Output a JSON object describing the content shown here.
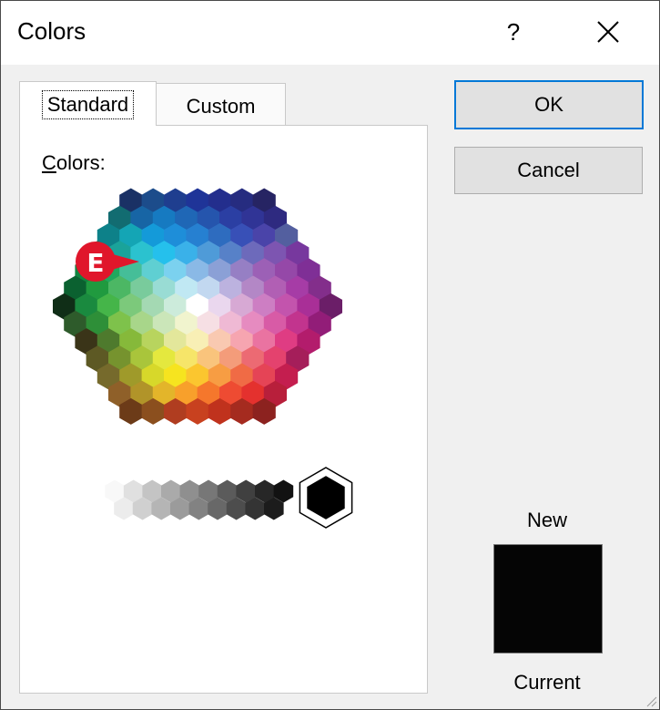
{
  "window": {
    "title": "Colors",
    "help_label": "?"
  },
  "tabs": [
    {
      "label": "Standard",
      "selected": true
    },
    {
      "label": "Custom",
      "selected": false
    }
  ],
  "panel": {
    "colors_label": "Colors:",
    "accelerator": "C",
    "label_rest": "olors:"
  },
  "buttons": {
    "ok_label": "OK",
    "cancel_label": "Cancel"
  },
  "preview": {
    "new_label": "New",
    "current_label": "Current",
    "new_color": "#050505",
    "current_color": "#050505"
  },
  "callout": {
    "letter": "E",
    "color": "#e0162b"
  },
  "selected_color": "#000000",
  "palette": {
    "rows": [
      [
        "#1a3165",
        "#1c4c8b",
        "#1f3e8f",
        "#1f3498",
        "#232e8d",
        "#262c80",
        "#262463"
      ],
      [
        "#126c71",
        "#1765a5",
        "#167ac1",
        "#1f67b6",
        "#2555ad",
        "#2b3fa3",
        "#303496",
        "#2e2a80"
      ],
      [
        "#0d8189",
        "#14a5b5",
        "#149ad9",
        "#1e8ed9",
        "#2680d1",
        "#2e6cbf",
        "#3850b7",
        "#4a44a9",
        "#535f9f"
      ],
      [
        "#0c7e5a",
        "#1aa39a",
        "#2bc2cf",
        "#25c0ec",
        "#3ab1e9",
        "#4f9bd8",
        "#5781c8",
        "#6d6abb",
        "#7d55b1",
        "#77389e"
      ],
      [
        "#11843f",
        "#21a85e",
        "#45be98",
        "#5fcfd2",
        "#7bd1ef",
        "#8ab9e6",
        "#8ba0d6",
        "#967fc4",
        "#9c60b6",
        "#9548a8",
        "#7f2f96"
      ],
      [
        "#0b6130",
        "#209a3f",
        "#4cb764",
        "#79cb9c",
        "#99dcd4",
        "#c0e8f3",
        "#c2d8f0",
        "#bcb2df",
        "#b387c6",
        "#b15fb4",
        "#a63ca6",
        "#832e8b"
      ],
      [
        "#102e17",
        "#1a8a3f",
        "#45b549",
        "#7cc97b",
        "#a4d9b3",
        "#ccebdb",
        "#ffffff",
        "#ead7ee",
        "#d7a9d4",
        "#cd7ec3",
        "#c354ad",
        "#a92f97",
        "#6b1e68"
      ],
      [
        "#2e5b2b",
        "#2e8f38",
        "#7ec24b",
        "#a8d68a",
        "#cbe6b9",
        "#f1f4ce",
        "#f6dfe4",
        "#efb9d4",
        "#e68bc0",
        "#d85ba6",
        "#c2348e",
        "#921d78"
      ],
      [
        "#3a3418",
        "#4e7a2d",
        "#86b93a",
        "#b8d45e",
        "#e3e79b",
        "#f8efb5",
        "#f9c9b1",
        "#f6a5b0",
        "#ea73a1",
        "#df3c83",
        "#b31c6c"
      ],
      [
        "#5d5924",
        "#76932e",
        "#a9c53b",
        "#e4e83e",
        "#f6e569",
        "#f9c47c",
        "#f49c7a",
        "#ec6a73",
        "#e4426e",
        "#a51e5a"
      ],
      [
        "#766a2c",
        "#9f9a2a",
        "#d7d82a",
        "#f6e41f",
        "#fbc62f",
        "#f79d43",
        "#f06b45",
        "#e54456",
        "#c41e4f"
      ],
      [
        "#8f6029",
        "#b19429",
        "#e3b52a",
        "#f8a02b",
        "#f5772c",
        "#ee4b32",
        "#e4312e",
        "#b81f3b"
      ],
      [
        "#6c3b18",
        "#8b4f1e",
        "#b03d20",
        "#c8411f",
        "#c0321d",
        "#a52b1f",
        "#8c221f"
      ]
    ],
    "grays_top": [
      "#f8f8f8",
      "#e0e0e0",
      "#c4c4c4",
      "#aaaaaa",
      "#8f8f8f",
      "#777777",
      "#5b5b5b",
      "#404040",
      "#272727",
      "#121212"
    ],
    "grays_bottom": [
      "#ececec",
      "#d0d0d0",
      "#b5b5b5",
      "#9b9b9b",
      "#828282",
      "#686868",
      "#4d4d4d",
      "#343434",
      "#1c1c1c"
    ]
  }
}
